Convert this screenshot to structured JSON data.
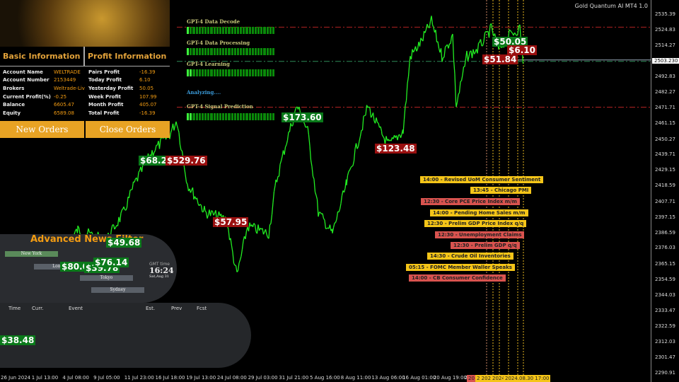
{
  "window": {
    "title": "Gold Quantum AI MT4 1.0",
    "current_price": "2503.230"
  },
  "basic": {
    "title": "Basic Information",
    "rows": [
      {
        "k": "Account Name",
        "v": "WELTRADE"
      },
      {
        "k": "Account Number",
        "v": "2153449"
      },
      {
        "k": "Brokers",
        "v": "Weltrade-Liv"
      },
      {
        "k": "Current Profit(%)",
        "v": "-0.25"
      },
      {
        "k": "Balance",
        "v": "6605.47"
      },
      {
        "k": "Equity",
        "v": "6589.08"
      }
    ]
  },
  "profit": {
    "title": "Profit Information",
    "rows": [
      {
        "k": "Pairs Profit",
        "v": "-16.39"
      },
      {
        "k": "Today Profit",
        "v": "6.10"
      },
      {
        "k": "Yesterday Profit",
        "v": "50.05"
      },
      {
        "k": "Week Profit",
        "v": "107.99"
      },
      {
        "k": "Month Profit",
        "v": "405.07"
      },
      {
        "k": "Total Profit",
        "v": "-16.39"
      }
    ]
  },
  "buttons": {
    "new_orders": "New Orders",
    "close_orders": "Close Orders"
  },
  "gpt": {
    "decode": "GPT-4 Data Decode",
    "processing": "GPT-4 Data Processing",
    "learning": "GPT-4 Learning",
    "analyzing": "Analyzing....",
    "signal": "GPT-4 Signal Prediction"
  },
  "trade_tags": [
    "$68.20",
    "$529.76",
    "$57.95",
    "$173.60",
    "$123.48",
    "$51.84",
    "$50.05",
    "$6.10",
    "$49.68",
    "$80.08",
    "$39.78",
    "$76.14",
    "$38.48"
  ],
  "events": [
    {
      "t": "14:00 - Revised UoM Consumer Sentiment",
      "c": "yellow"
    },
    {
      "t": "13:45 - Chicago PMI",
      "c": "yellow"
    },
    {
      "t": "12:30 - Core PCE Price Index m/m",
      "c": "red"
    },
    {
      "t": "14:00 - Pending Home Sales m/m",
      "c": "yellow"
    },
    {
      "t": "12:30 - Prelim GDP Price Index q/q",
      "c": "yellow"
    },
    {
      "t": "12:30 - Unemployment Claims",
      "c": "red"
    },
    {
      "t": "12:30 - Prelim GDP q/q",
      "c": "red"
    },
    {
      "t": "14:30 - Crude Oil Inventories",
      "c": "yellow"
    },
    {
      "t": "05:15 - FOMC Member Waller Speaks",
      "c": "yellow"
    },
    {
      "t": "14:00 - CB Consumer Confidence",
      "c": "red"
    }
  ],
  "news": {
    "title": "Advanced News Filter",
    "sessions": [
      "New York",
      "London",
      "Tokyo",
      "Sydney"
    ],
    "gmt_label": "GMT time",
    "gmt_time": "16:24",
    "gmt_date": "Sat,Aug 31",
    "columns": [
      "Time",
      "Curr.",
      "Event",
      "Est.",
      "Prev",
      "Fcst"
    ]
  },
  "colors": {
    "candle": "#22ee22",
    "accent": "#e8a324",
    "resistance": "#b22222",
    "support": "#2e8b57"
  },
  "chart_data": {
    "type": "line",
    "symbol_price_axis": [
      2535.39,
      2524.83,
      2514.27,
      2503.23,
      2492.83,
      2482.27,
      2471.71,
      2461.15,
      2450.27,
      2439.71,
      2429.15,
      2418.59,
      2407.71,
      2397.15,
      2386.59,
      2376.03,
      2365.15,
      2354.59,
      2344.03,
      2333.47,
      2322.59,
      2312.03,
      2301.47,
      2290.91
    ],
    "ylim": [
      2290.91,
      2535.39
    ],
    "x_ticks": [
      "26 Jun 2024",
      "1 Jul 13:00",
      "4 Jul 08:00",
      "9 Jul 05:00",
      "11 Jul 23:00",
      "16 Jul 18:00",
      "19 Jul 13:00",
      "24 Jul 08:00",
      "29 Jul 03:00",
      "31 Jul 21:00",
      "5 Aug 16:00",
      "8 Aug 11:00",
      "13 Aug 06:00",
      "16 Aug 01:00",
      "20 Aug 19:00",
      "23"
    ],
    "x_markers": [
      "20",
      "2 202",
      "2024",
      "2024.08.30 17:00"
    ],
    "prices": [
      2313.6,
      2333.1,
      2388.3,
      2381.1,
      2400.4,
      2419.7,
      2441.4,
      2453.4,
      2463.1,
      2419.7,
      2400.4,
      2395.6,
      2357.0,
      2390.7,
      2385.9,
      2419.7,
      2448.6,
      2472.7,
      2455.8,
      2400.4,
      2385.9,
      2419.7,
      2472.7,
      2453.4,
      2446.2,
      2455.8,
      2506.5,
      2516.1,
      2530.6,
      2506.5,
      2521.0,
      2472.7,
      2506.5,
      2511.3,
      2525.7,
      2511.3,
      2521.0,
      2525.7,
      2501.6
    ],
    "levels": {
      "resistance": [
        2526.5,
        2472.0
      ],
      "support": 2503.23
    }
  }
}
